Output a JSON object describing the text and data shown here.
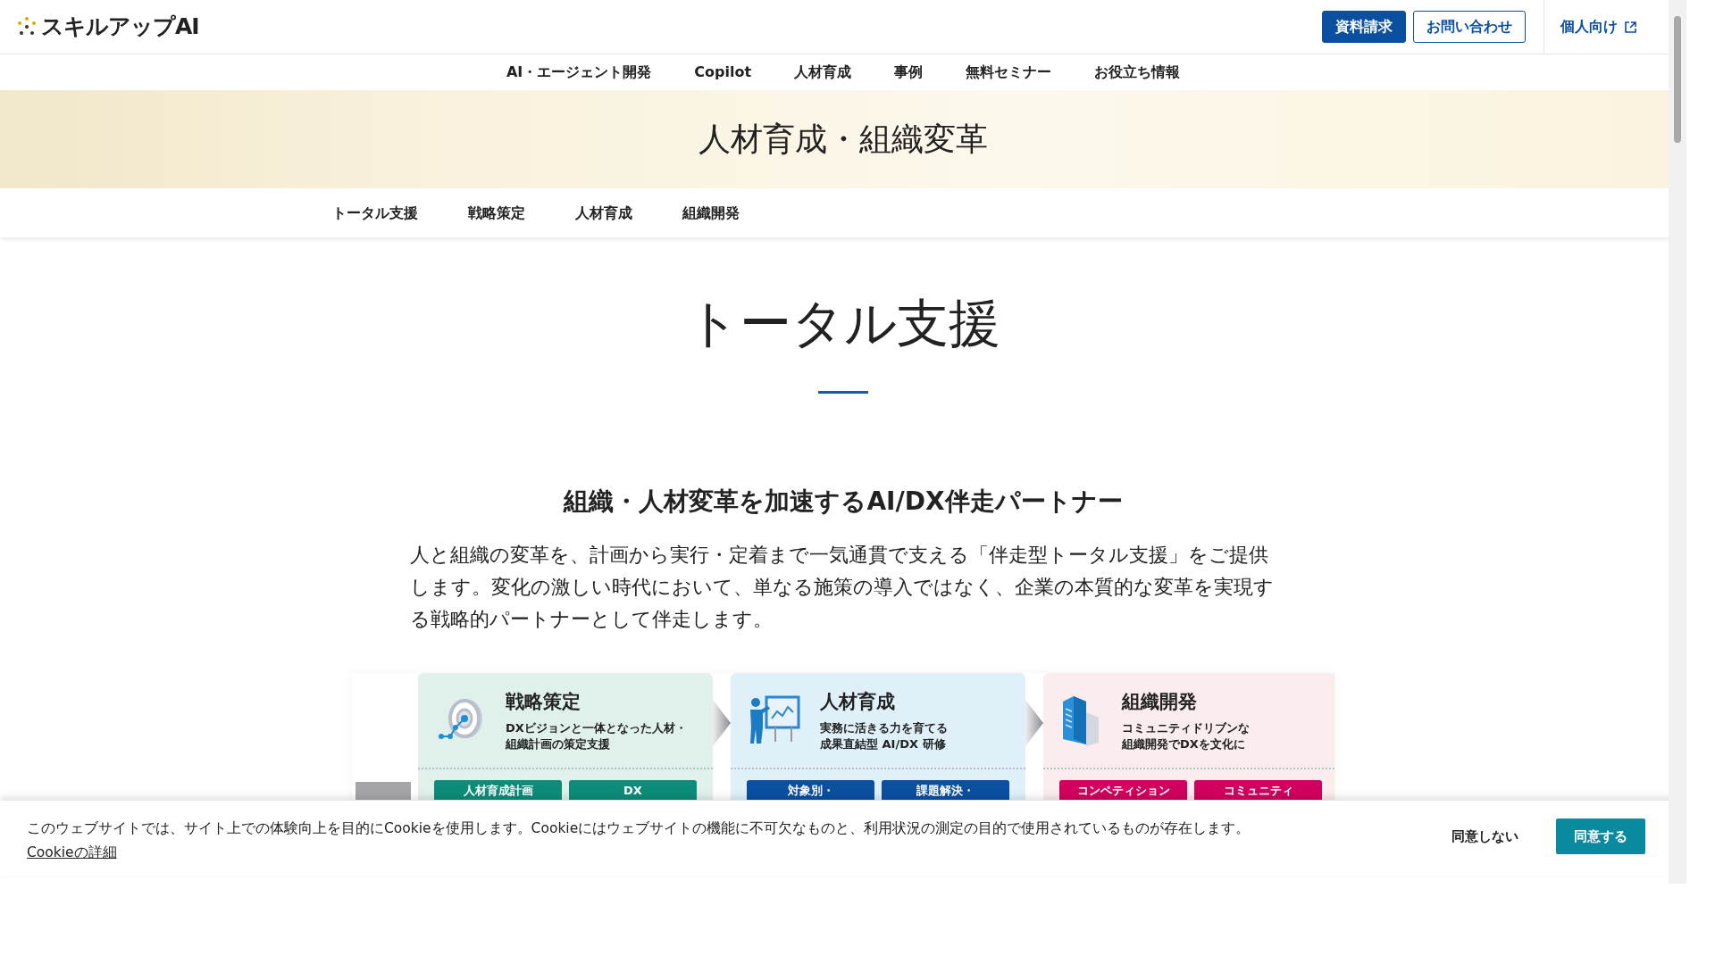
{
  "header": {
    "logo": "スキルアップAI",
    "buttons": [
      {
        "label": "資料請求",
        "kind": "solid"
      },
      {
        "label": "お問い合わせ",
        "kind": "outline"
      }
    ],
    "personal_link": "個人向け"
  },
  "nav": [
    "AI・エージェント開発",
    "Copilot",
    "人材育成",
    "事例",
    "無料セミナー",
    "お役立ち情報"
  ],
  "banner": {
    "title": "人材育成・組織変革"
  },
  "subnav": [
    "トータル支援",
    "戦略策定",
    "人材育成",
    "組織開発"
  ],
  "section": {
    "title": "トータル支援",
    "subtitle": "組織・人材変革を加速するAI/DX伴走パートナー",
    "lead": "人と組織の変革を、計画から実行・定着まで一気通貫で支える「伴走型トータル支援」をご提供します。変化の激しい時代において、単なる施策の導入ではなく、企業の本質的な変革を実現する戦略的パートナーとして伴走します。"
  },
  "diagram": {
    "cards": [
      {
        "kind": "target",
        "title": "戦略策定",
        "lines": [
          "DXビジョンと一体となった人材・",
          "組織計画の策定支援"
        ],
        "color": "#0e8c7a",
        "buttons": [
          "人材育成計画",
          "DX"
        ]
      },
      {
        "kind": "presenter",
        "title": "人材育成",
        "lines": [
          "実務に活きる力を育てる",
          "成果直結型 AI/DX 研修"
        ],
        "color": "#0a4fa0",
        "buttons": [
          "対象別・",
          "課題解決・"
        ]
      },
      {
        "kind": "building",
        "title": "組織開発",
        "lines": [
          "コミュニティドリブンな",
          "組織開発でDXを文化に"
        ],
        "color": "#d0005f",
        "buttons": [
          "コンペティション",
          "コミュニティ"
        ]
      }
    ]
  },
  "cookie_bar": {
    "text": "このウェブサイトでは、サイト上での体験向上を目的にCookieを使用します。Cookieにはウェブサイトの機能に不可欠なものと、利用状況の測定の目的で使用されているものが存在します。",
    "link": "Cookieの詳細",
    "decline": "同意しない",
    "accept": "同意する"
  }
}
